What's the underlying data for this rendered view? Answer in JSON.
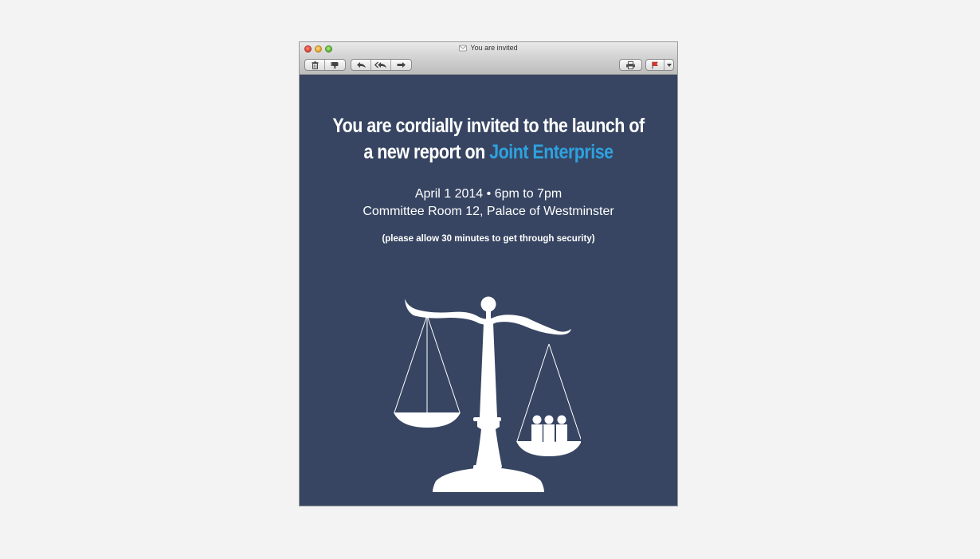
{
  "window": {
    "title": "You are invited"
  },
  "toolbar": {
    "icons": [
      "trash-icon",
      "junk-icon",
      "reply-icon",
      "reply-all-icon",
      "forward-icon",
      "print-icon",
      "flag-icon"
    ]
  },
  "invite": {
    "headline_line1": "You are cordially invited to the launch of",
    "headline_line2_prefix": "a new report on ",
    "headline_highlight": "Joint Enterprise",
    "date_time": "April 1 2014 • 6pm to 7pm",
    "location": "Committee Room 12, Palace of Westminster",
    "security_note": "(please allow 30 minutes to get through security)"
  },
  "colors": {
    "background": "#f3f3f3",
    "email_body": "#374562",
    "accent": "#2ea1df",
    "text": "#ffffff"
  }
}
